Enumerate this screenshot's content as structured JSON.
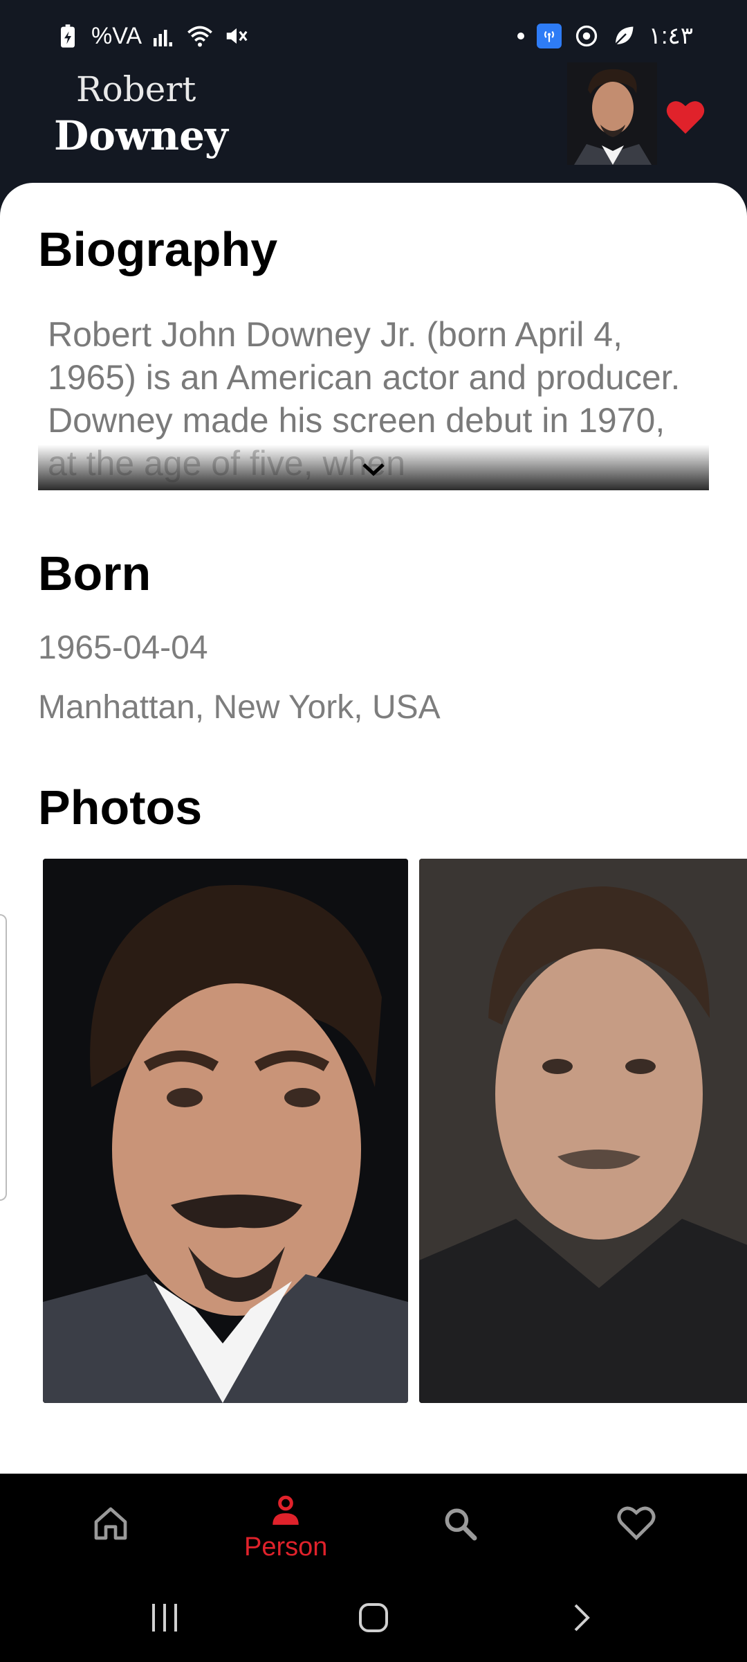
{
  "status_bar": {
    "battery": "%VA",
    "time": "١:٤٣"
  },
  "header": {
    "first_name": "Robert",
    "last_name": "Downey"
  },
  "biography": {
    "heading": "Biography",
    "text": "Robert John Downey Jr. (born April 4, 1965) is an American actor and producer. Downey made his screen debut in 1970, at the age of five, when"
  },
  "born": {
    "heading": "Born",
    "date": "1965-04-04",
    "place": "Manhattan, New York, USA"
  },
  "photos": {
    "heading": "Photos"
  },
  "bottom_nav": {
    "person_label": "Person"
  },
  "colors": {
    "accent": "#e0222b",
    "header_bg": "#131822"
  }
}
